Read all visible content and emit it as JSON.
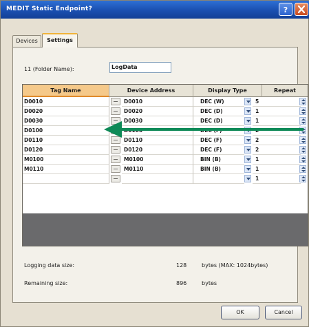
{
  "window": {
    "title": "MEDIT Static Endpoint?",
    "help_label": "?",
    "close_label": "x"
  },
  "tabs": [
    {
      "label": "Devices"
    },
    {
      "label": "Settings"
    }
  ],
  "folder": {
    "label": "11 (Folder Name):",
    "value": "LogData"
  },
  "table": {
    "columns": [
      "Tag Name",
      "Device Address",
      "Display Type",
      "Repeat"
    ],
    "rows": [
      {
        "tag": "D0010",
        "device": "D0010",
        "display": "DEC (W)",
        "repeat": "5"
      },
      {
        "tag": "D0020",
        "device": "D0020",
        "display": "DEC (D)",
        "repeat": "1"
      },
      {
        "tag": "D0030",
        "device": "D0030",
        "display": "DEC (D)",
        "repeat": "1"
      },
      {
        "tag": "D0100",
        "device": "D0100",
        "display": "DEC (F)",
        "repeat": "2"
      },
      {
        "tag": "D0110",
        "device": "D0110",
        "display": "DEC (F)",
        "repeat": "2"
      },
      {
        "tag": "D0120",
        "device": "D0120",
        "display": "DEC (F)",
        "repeat": "2"
      },
      {
        "tag": "M0100",
        "device": "M0100",
        "display": "BIN (B)",
        "repeat": "1"
      },
      {
        "tag": "M0110",
        "device": "M0110",
        "display": "BIN (B)",
        "repeat": "1"
      },
      {
        "tag": "",
        "device": "",
        "display": "",
        "repeat": "1"
      }
    ]
  },
  "info": {
    "logging_label": "Logging data size:",
    "logging_value": "128",
    "logging_unit": "bytes (MAX: 1024bytes)",
    "remaining_label": "Remaining size:",
    "remaining_value": "896",
    "remaining_unit": "bytes"
  },
  "buttons": {
    "ok": "OK",
    "cancel": "Cancel"
  },
  "colors": {
    "annotation_arrow": "#0e8a57",
    "tag_header": "#f5c98a"
  }
}
